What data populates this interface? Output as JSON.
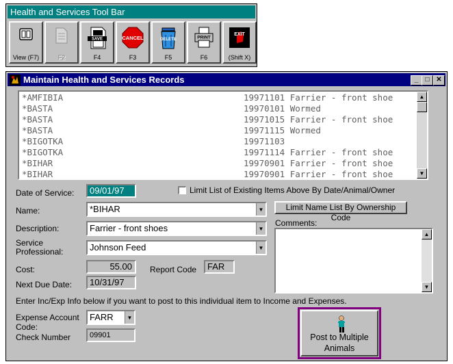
{
  "toolbar": {
    "title": "Health and Services Tool Bar",
    "buttons": [
      {
        "label": "View (F7)",
        "icon": "view-icon",
        "enabled": true
      },
      {
        "label": "F2",
        "icon": "new-record-icon",
        "enabled": false
      },
      {
        "label": "F4",
        "icon": "save-icon",
        "enabled": true
      },
      {
        "label": "F3",
        "icon": "cancel-icon",
        "enabled": true
      },
      {
        "label": "F5",
        "icon": "delete-icon",
        "enabled": true
      },
      {
        "label": "F6",
        "icon": "print-icon",
        "enabled": true
      },
      {
        "label": "(Shift X)",
        "icon": "exit-icon",
        "enabled": true
      }
    ],
    "icon_text": {
      "save": "SAVE",
      "cancel": "CANCEL",
      "delete": "DELETE",
      "print": "PRINT",
      "exit": "EXIT"
    }
  },
  "window": {
    "title": "Maintain Health and Services Records",
    "controls": [
      "minimize",
      "maximize",
      "close"
    ]
  },
  "records": [
    {
      "name": "*AMFIBIA",
      "entry": "19971101 Farrier - front shoe"
    },
    {
      "name": "*BASTA",
      "entry": "19970101 Wormed"
    },
    {
      "name": "*BASTA",
      "entry": "19971015 Farrier - front shoe"
    },
    {
      "name": "*BASTA",
      "entry": "19971115 Wormed"
    },
    {
      "name": "*BIGOTKA",
      "entry": "19971103"
    },
    {
      "name": "*BIGOTKA",
      "entry": "19971114 Farrier - front shoe"
    },
    {
      "name": "*BIHAR",
      "entry": "19970901 Farrier - front shoe"
    },
    {
      "name": "*BIHAR",
      "entry": "19970901 Farrier - front shoe"
    }
  ],
  "form": {
    "date_label": "Date of Service:",
    "date_value": "09/01/97",
    "limit_list_label": "Limit List of Existing Items Above By Date/Animal/Owner",
    "limit_list_checked": false,
    "name_label": "Name:",
    "name_value": "*BIHAR",
    "limit_name_button": "Limit Name List By Ownership Code",
    "description_label": "Description:",
    "description_value": "Farrier - front shoes",
    "comments_label": "Comments:",
    "comments_value": "",
    "professional_label_1": "Service",
    "professional_label_2": "Professional:",
    "professional_value": "Johnson Feed",
    "cost_label": "Cost:",
    "cost_value": "55.00",
    "report_code_label": "Report Code",
    "report_code_value": "FAR",
    "next_due_label": "Next Due Date:",
    "next_due_value": "10/31/97",
    "inc_exp_note": "Enter Inc/Exp Info below if you want to post to this individual item to Income and Expenses.",
    "expense_label_1": "Expense Account",
    "expense_label_2": "Code:",
    "expense_value": "FARR",
    "check_label": "Check Number",
    "check_value": "09901",
    "post_button_1": "Post to Multiple",
    "post_button_2": "Animals"
  },
  "colors": {
    "window_title_bg": "#000080",
    "toolbar_title_bg": "#008080",
    "face": "#c0c0c0",
    "post_border": "#800080"
  }
}
